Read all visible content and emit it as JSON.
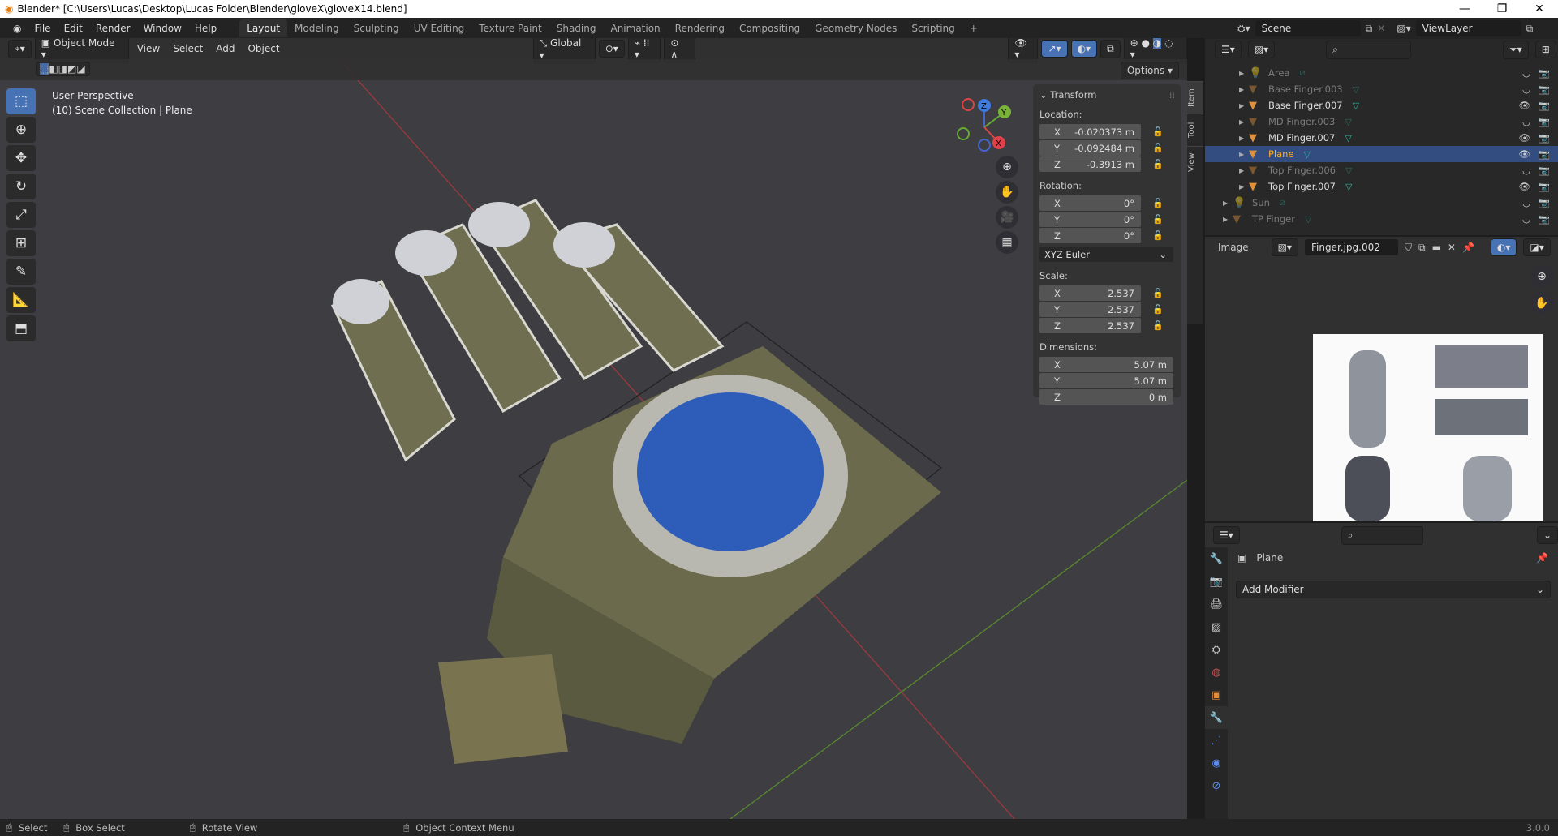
{
  "title": "Blender* [C:\\Users\\Lucas\\Desktop\\Lucas Folder\\Blender\\gloveX\\gloveX14.blend]",
  "menu": [
    "File",
    "Edit",
    "Render",
    "Window",
    "Help"
  ],
  "workspaces": [
    "Layout",
    "Modeling",
    "Sculpting",
    "UV Editing",
    "Texture Paint",
    "Shading",
    "Animation",
    "Rendering",
    "Compositing",
    "Geometry Nodes",
    "Scripting",
    "+"
  ],
  "viewport": {
    "mode": "Object Mode",
    "menus": [
      "View",
      "Select",
      "Add",
      "Object"
    ],
    "orientation": "Global",
    "options": "Options",
    "info_line1": "User Perspective",
    "info_line2": "(10) Scene Collection | Plane",
    "gizmo_axes": [
      "X",
      "Y",
      "Z"
    ]
  },
  "npanel": {
    "title": "Transform",
    "tabs": [
      "Item",
      "Tool",
      "View"
    ],
    "location_label": "Location:",
    "location": [
      {
        "axis": "X",
        "value": "-0.020373 m"
      },
      {
        "axis": "Y",
        "value": "-0.092484 m"
      },
      {
        "axis": "Z",
        "value": "-0.3913 m"
      }
    ],
    "rotation_label": "Rotation:",
    "rotation": [
      {
        "axis": "X",
        "value": "0°"
      },
      {
        "axis": "Y",
        "value": "0°"
      },
      {
        "axis": "Z",
        "value": "0°"
      }
    ],
    "rotation_mode": "XYZ Euler",
    "scale_label": "Scale:",
    "scale": [
      {
        "axis": "X",
        "value": "2.537"
      },
      {
        "axis": "Y",
        "value": "2.537"
      },
      {
        "axis": "Z",
        "value": "2.537"
      }
    ],
    "dimensions_label": "Dimensions:",
    "dimensions": [
      {
        "axis": "X",
        "value": "5.07 m"
      },
      {
        "axis": "Y",
        "value": "5.07 m"
      },
      {
        "axis": "Z",
        "value": "0 m"
      }
    ]
  },
  "scene": {
    "scene": "Scene",
    "view_layer": "ViewLayer"
  },
  "outliner": [
    {
      "name": "Area",
      "type": "light",
      "visible": false,
      "selected": false
    },
    {
      "name": "Base Finger.003",
      "type": "mesh",
      "visible": false,
      "selected": false
    },
    {
      "name": "Base Finger.007",
      "type": "mesh",
      "visible": true,
      "selected": false
    },
    {
      "name": "MD Finger.003",
      "type": "mesh",
      "visible": false,
      "selected": false
    },
    {
      "name": "MD Finger.007",
      "type": "mesh",
      "visible": true,
      "selected": false
    },
    {
      "name": "Plane",
      "type": "mesh",
      "visible": true,
      "selected": true
    },
    {
      "name": "Top Finger.006",
      "type": "mesh",
      "visible": false,
      "selected": false
    },
    {
      "name": "Top Finger.007",
      "type": "mesh",
      "visible": true,
      "selected": false
    },
    {
      "name": "Sun",
      "type": "light",
      "visible": false,
      "selected": false
    },
    {
      "name": "TP Finger",
      "type": "mesh",
      "visible": false,
      "selected": false
    }
  ],
  "image_editor": {
    "label": "Image",
    "image_name": "Finger.jpg.002"
  },
  "properties": {
    "object": "Plane",
    "add_modifier": "Add Modifier"
  },
  "status": {
    "select": "Select",
    "box_select": "Box Select",
    "rotate": "Rotate View",
    "context": "Object Context Menu",
    "version": "3.0.0"
  },
  "colors": {
    "accent": "#4772b3",
    "selected_row": "#334d80",
    "active_object": "#ffaf29",
    "viewport_bg": "#3d3d42"
  }
}
